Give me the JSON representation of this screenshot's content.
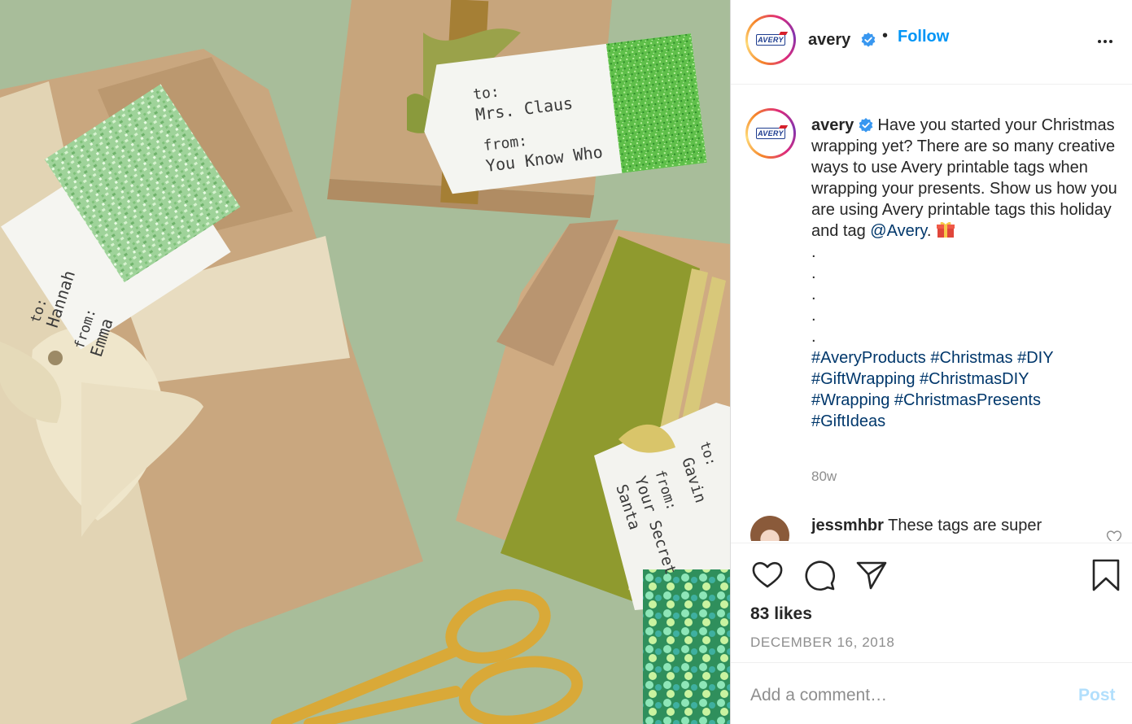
{
  "header": {
    "username": "avery",
    "separator": "•",
    "follow_label": "Follow",
    "avatar_logo_text": "AVERY"
  },
  "caption": {
    "username": "avery",
    "text_before_mention": "Have you started your Christmas wrapping yet? There are so many creative ways to use Avery printable tags when wrapping your presents. Show us how you are using Avery printable tags this holiday and tag ",
    "mention": "@Avery",
    "text_after_mention": ".",
    "dots": [
      ".",
      ".",
      ".",
      ".",
      "."
    ],
    "hashtags": [
      "#AveryProducts",
      "#Christmas",
      "#DIY",
      "#GiftWrapping",
      "#ChristmasDIY",
      "#Wrapping",
      "#ChristmasPresents",
      "#GiftIdeas"
    ],
    "age": "80w"
  },
  "comment": {
    "username": "jessmhbr",
    "text": "These tags are super"
  },
  "actions": {
    "likes": "83 likes",
    "date": "DECEMBER 16, 2018"
  },
  "add_comment": {
    "placeholder": "Add a comment…",
    "post_label": "Post"
  },
  "photo": {
    "tags": [
      {
        "to_label": "to:",
        "to_name": "Mrs. Claus",
        "from_label": "from:",
        "from_name": "You Know Who"
      },
      {
        "to_label": "to:",
        "to_name": "Hannah",
        "from_label": "from:",
        "from_name": "Emma"
      },
      {
        "to_label": "to:",
        "to_name": "Gavin",
        "from_label": "from:",
        "from_name_line1": "Your Secret",
        "from_name_line2": "Santa"
      }
    ]
  },
  "colors": {
    "link": "#0095f6",
    "hashtag": "#00376b",
    "muted": "#8e8e8e",
    "post_disabled": "#b2dffc",
    "verified": "#3897f0"
  }
}
